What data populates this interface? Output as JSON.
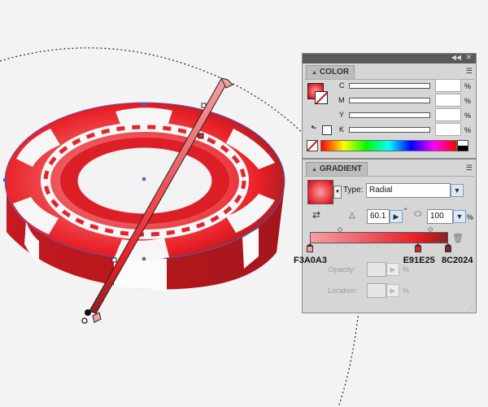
{
  "colors": {
    "chip_red": "#e91e25",
    "chip_dark": "#8c2024",
    "chip_light": "#f3a0a3",
    "panel_bg": "#d6d6d6"
  },
  "color_panel": {
    "tab": "COLOR",
    "channels": [
      {
        "label": "C",
        "value": "",
        "unit": "%"
      },
      {
        "label": "M",
        "value": "",
        "unit": "%"
      },
      {
        "label": "Y",
        "value": "",
        "unit": "%"
      },
      {
        "label": "K",
        "value": "",
        "unit": "%"
      }
    ]
  },
  "gradient_panel": {
    "tab": "GRADIENT",
    "type_label": "Type:",
    "type_value": "Radial",
    "angle_value": "60.1",
    "angle_unit": "°",
    "aspect_value": "100",
    "aspect_unit": "%",
    "stops": [
      {
        "label": "F3A0A3",
        "color": "#f3a0a3",
        "position": 0
      },
      {
        "label": "E91E25",
        "color": "#e91e25",
        "position": 78
      },
      {
        "label": "8C2024",
        "color": "#8c2024",
        "position": 100
      }
    ],
    "opacity_label": "Opacity:",
    "opacity_unit": "%",
    "location_label": "Location:",
    "location_unit": "%"
  }
}
